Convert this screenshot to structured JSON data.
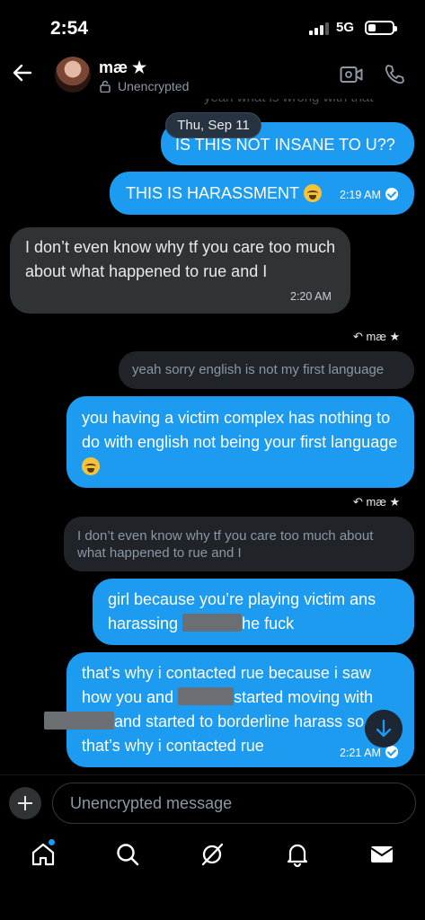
{
  "status_bar": {
    "time": "2:54",
    "network": "5G",
    "battery_level": 0.3
  },
  "header": {
    "contact_name": "mæ ★",
    "encryption_label": "Unencrypted"
  },
  "chat": {
    "faded_top_text": "yeah what is wrong with that",
    "date_divider": "Thu, Sep 11",
    "messages": [
      {
        "direction": "outgoing",
        "text": "IS THIS NOT INSANE TO U??"
      },
      {
        "direction": "outgoing",
        "text": "THIS IS HARASSMENT",
        "emoji": "loudly-crying-face",
        "time": "2:19 AM",
        "read": true
      },
      {
        "direction": "incoming",
        "text": "I don’t even know why tf you care too much about what happened to rue and I",
        "time": "2:20 AM"
      },
      {
        "direction": "outgoing",
        "reply_to_name": "mæ ★",
        "quoted_text": "yeah sorry english is not my first language",
        "text": "you having a victim complex has nothing to do with english not being your first language",
        "emoji": "loudly-crying-face"
      },
      {
        "direction": "outgoing",
        "reply_to_name": "mæ ★",
        "quoted_text": "I don’t even know why tf you care too much about what happened to rue and I",
        "text_parts": [
          "girl because you’re playing victim ans harassing ",
          "he fuck"
        ],
        "redacted": true
      },
      {
        "direction": "outgoing",
        "text_parts": [
          "that’s why i contacted rue because i saw how you and ",
          "started moving with ",
          "and started to borderline harass ",
          "so that’s why i contacted rue"
        ],
        "redacted": true,
        "time": "2:21 AM",
        "read": true
      }
    ]
  },
  "composer": {
    "placeholder": "Unencrypted message"
  },
  "tabs": [
    "home-icon",
    "search-icon",
    "grok-icon",
    "notifications-icon",
    "messages-icon"
  ],
  "colors": {
    "accent": "#1d9bf0",
    "incoming_bubble": "#2f3336",
    "background": "#000000"
  }
}
